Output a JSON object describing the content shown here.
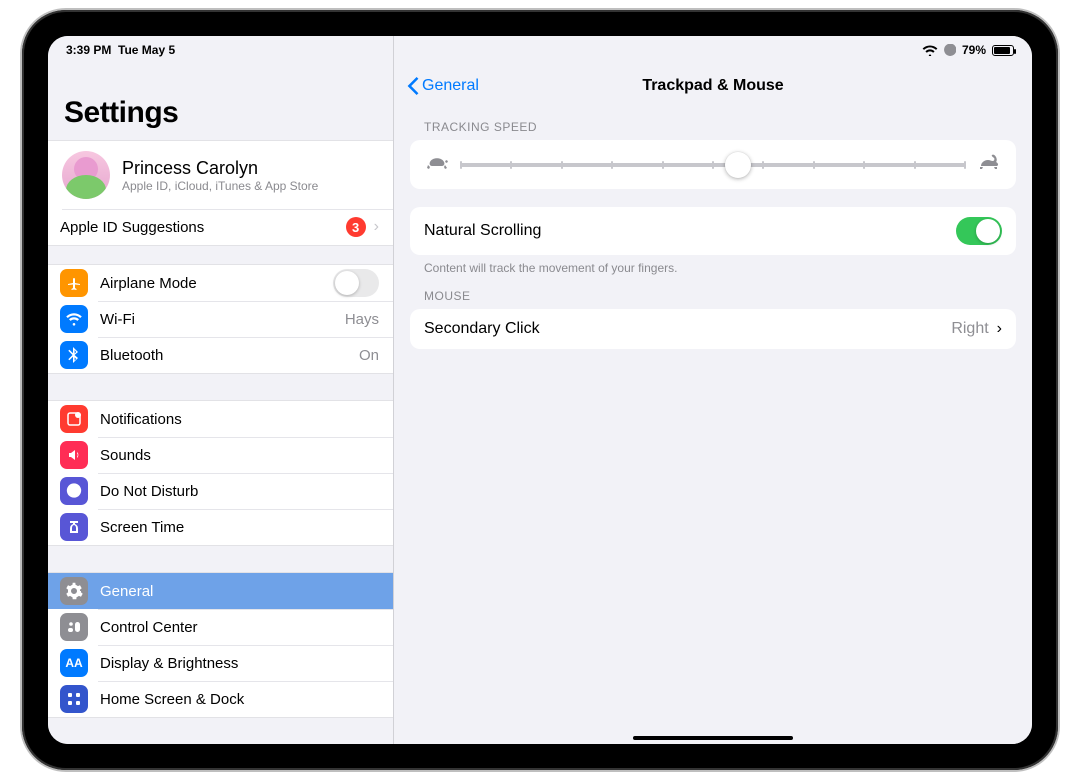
{
  "status": {
    "time": "3:39 PM",
    "date": "Tue May 5",
    "battery": "79%"
  },
  "sidebar": {
    "title": "Settings",
    "profile": {
      "name": "Princess Carolyn",
      "subtitle": "Apple ID, iCloud, iTunes & App Store"
    },
    "apple_id_suggestions": {
      "label": "Apple ID Suggestions",
      "badge": "3"
    },
    "airplane": "Airplane Mode",
    "wifi": {
      "label": "Wi-Fi",
      "value": "Hays"
    },
    "bluetooth": {
      "label": "Bluetooth",
      "value": "On"
    },
    "notifications": "Notifications",
    "sounds": "Sounds",
    "dnd": "Do Not Disturb",
    "screentime": "Screen Time",
    "general": "General",
    "controlcenter": "Control Center",
    "display": "Display & Brightness",
    "homescreen": "Home Screen & Dock"
  },
  "detail": {
    "back": "General",
    "title": "Trackpad & Mouse",
    "tracking_header": "TRACKING SPEED",
    "tracking_value_percent": 55,
    "natural_label": "Natural Scrolling",
    "natural_on": true,
    "natural_note": "Content will track the movement of your fingers.",
    "mouse_header": "MOUSE",
    "secondary_label": "Secondary Click",
    "secondary_value": "Right"
  }
}
